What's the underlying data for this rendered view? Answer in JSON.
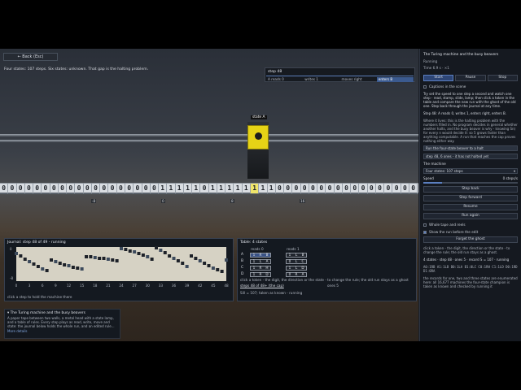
{
  "scene": {
    "back_label": "←  Back  (Esc)",
    "caption": "Four states: 107 steps. Six states: unknown. That gap is the halting problem.",
    "state_tag": "state A",
    "step_box": {
      "title": "step 48",
      "cells": [
        "A reads 0",
        "writes 1",
        "moves right",
        "enters B"
      ],
      "highlight_index": 3
    },
    "tape": [
      "0",
      "0",
      "0",
      "0",
      "0",
      "0",
      "0",
      "0",
      "0",
      "0",
      "0",
      "0",
      "0",
      "0",
      "0",
      "0",
      "0",
      "0",
      "0",
      "1",
      "1",
      "1",
      "1",
      "1",
      "0",
      "1",
      "1",
      "1",
      "1",
      "1",
      "1",
      "1",
      "1",
      "0",
      "0",
      "0",
      "0",
      "0",
      "0",
      "0",
      "0",
      "0",
      "0",
      "0",
      "0",
      "0",
      "0",
      "0",
      "0",
      "0"
    ],
    "head_index": 30,
    "markers": [
      "-8",
      "0",
      "8",
      "16"
    ]
  },
  "journal": {
    "title": "Journal: step 48 of 49 - running",
    "y_labels": [
      "0",
      "-8"
    ],
    "x_ticks": [
      "0",
      "3",
      "6",
      "9",
      "12",
      "15",
      "18",
      "21",
      "24",
      "27",
      "30",
      "33",
      "36",
      "39",
      "42",
      "45",
      "48"
    ],
    "footer": "click a step to hold the machine there"
  },
  "table": {
    "title": "Table: 4 states",
    "read0": "reads 0",
    "read1": "reads 1",
    "rows": [
      {
        "state": "A",
        "r0": [
          "1",
          "R",
          "B"
        ],
        "r1": [
          "1",
          "L",
          "B"
        ]
      },
      {
        "state": "B",
        "r0": [
          "1",
          "L",
          "A"
        ],
        "r1": [
          "0",
          "L",
          "C"
        ]
      },
      {
        "state": "C",
        "r0": [
          "1",
          "R",
          "H"
        ],
        "r1": [
          "1",
          "L",
          "D"
        ]
      },
      {
        "state": "D",
        "r0": [
          "1",
          "R",
          "D"
        ],
        "r1": [
          "0",
          "R",
          "A"
        ]
      }
    ],
    "note1": "click a token - the digit, the direction or the state - to change the rule; the old run stays as a ghost",
    "note2": "steps 48 of 48+ (the cap)",
    "note2b": "ones 5",
    "note3": "Sill = 107; taken as known  -  running"
  },
  "info": {
    "title": "▾ The Turing machine and the busy beavers",
    "desc": "A paper tape between two walls, a metal head with a state lamp, and a table of rules. Every step plays as read, write, move and state: the journal below holds the whole run, and an edited rule...",
    "more": "More details"
  },
  "panel": {
    "title": "The Turing machine and the busy beavers",
    "status": "Running",
    "time": "Time 6.9 s  ·  ×1",
    "buttons": [
      "Start",
      "Pause",
      "Stop"
    ],
    "captions_label": "Captions in the scene",
    "intro": "Try set the speed to one step a second and watch one step - read, stamp, slide, lamp; then click a token in the table and compare the new run with the ghost of the old one. Step back through the journal at any time.",
    "step_line": "Step 48: A reads 0, writes 1, enters right, enters B.",
    "desc2": "Where it lives: this is the halting problem with the numbers filled in. No program decides in general whether another halts, and the busy beaver is why - knowing Sn) for every n would decide it: so 5 grows faster than anything computable. A run that reaches the cap proves nothing either way.",
    "input_label": "Run the four-state beaver to a halt",
    "input_value": "step 48, 6 ones - it has not halted yet",
    "machine_label": "The machine",
    "machine_select": "Four states: 107 steps",
    "speed_label": "Speed",
    "speed_value": "0 steps/s",
    "speed_fraction": 0.2,
    "wide_buttons_1": [
      "Step back",
      "Step forward",
      "Resume",
      "Run again"
    ],
    "whole_tape_label": "Whole tape and reels",
    "show_run_label": "Show the run before the edit",
    "forget_label": "Forget the ghost",
    "hint": "click a token - the digit, the direction or the state - to change the rule; the old run stays as a ghost.",
    "summary": "4 states · step 48 · ones 5 · record S = 107 · running",
    "code": "A0:1RB A1:1LB B0:1LA B1:0LC C0:1RH C1:1LD D0:1RD D1:0RA",
    "footer": "the records for one, two and three states are enumerated here: all 16,677 machines the four-state champion is taken as known and checked by running it"
  }
}
